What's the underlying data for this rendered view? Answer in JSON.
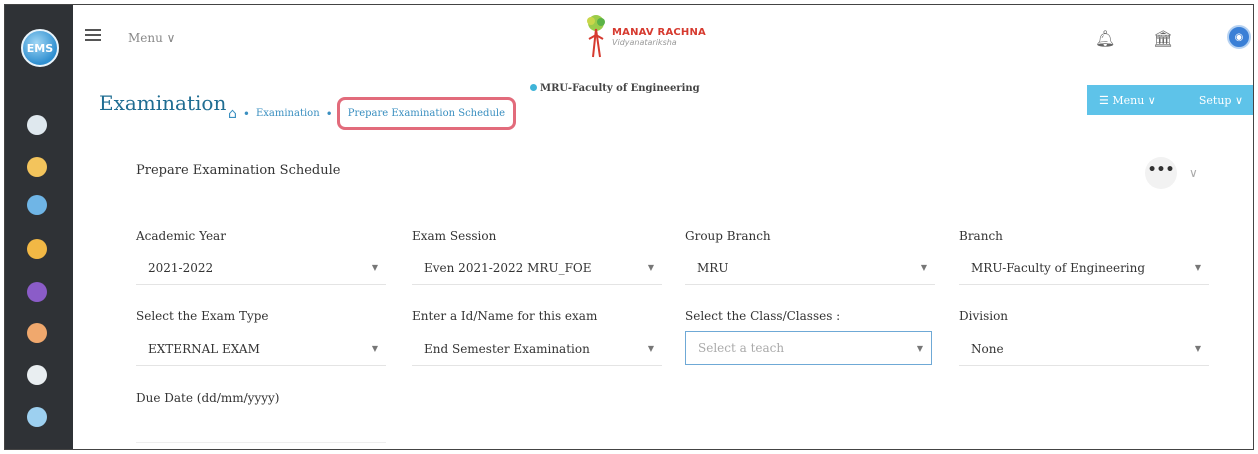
{
  "logo": "EMS",
  "topbar": {
    "menu_label": "Menu ∨",
    "brand_name": "MANAV RACHNA",
    "brand_tagline": "Vidyanatariksha",
    "campus": "MRU-Faculty of Engineering"
  },
  "header": {
    "title": "Examination",
    "breadcrumb": [
      "Examination",
      "Prepare Examination Schedule"
    ],
    "menu_button": "☰ Menu ∨",
    "setup_button": "Setup ∨"
  },
  "card": {
    "title": "Prepare Examination Schedule",
    "more": "•••",
    "collapse": "∨"
  },
  "form": {
    "academic_year": {
      "label": "Academic Year",
      "value": "2021-2022"
    },
    "exam_session": {
      "label": "Exam Session",
      "value": "Even 2021-2022 MRU_FOE"
    },
    "group_branch": {
      "label": "Group Branch",
      "value": "MRU"
    },
    "branch": {
      "label": "Branch",
      "value": "MRU-Faculty of Engineering"
    },
    "exam_type": {
      "label": "Select the Exam Type",
      "value": "EXTERNAL EXAM"
    },
    "exam_name": {
      "label": "Enter a Id/Name for this exam",
      "value": "End Semester Examination"
    },
    "classes": {
      "label": "Select the Class/Classes :",
      "placeholder": "Select a teach"
    },
    "division": {
      "label": "Division",
      "value": "None"
    },
    "due_date": {
      "label": "Due Date (dd/mm/yyyy)"
    }
  },
  "colors": {
    "sidebar": "#2f3236",
    "accent": "#5ec3e9",
    "title": "#1f6d92",
    "highlight": "#e26b7b"
  }
}
